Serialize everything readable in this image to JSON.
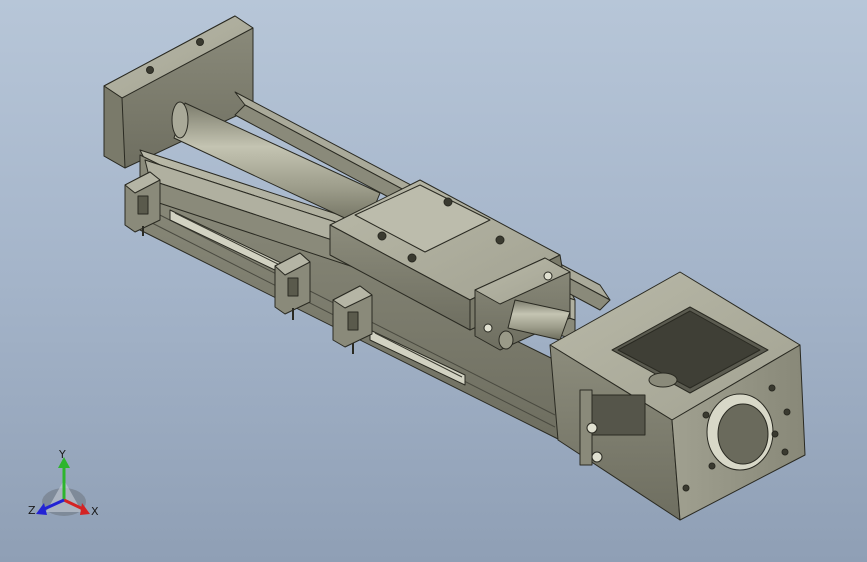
{
  "viewport": {
    "background_top": "#b7c6d8",
    "background_bottom": "#8f9fb5"
  },
  "model": {
    "part_color": "#8f8f80",
    "part_edge_color": "#2a2a22"
  },
  "triad": {
    "y_label": "Y",
    "x_label": "X",
    "z_label": "Z",
    "y_color": "#2db52d",
    "x_color": "#d42323",
    "z_color": "#2323d4"
  }
}
